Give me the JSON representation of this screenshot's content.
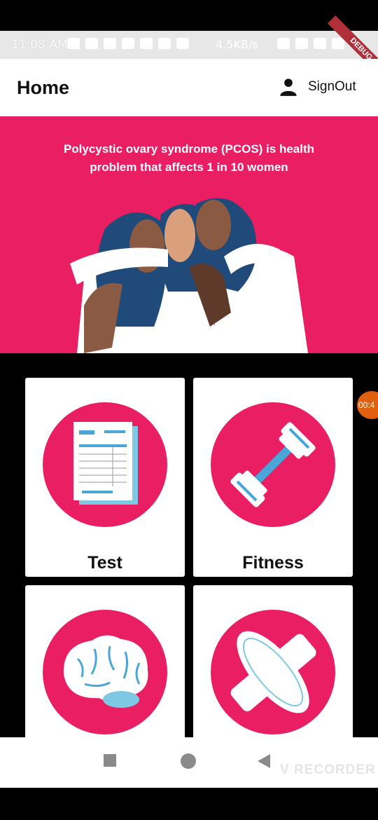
{
  "status": {
    "time": "11:08 AM",
    "speed": "4.5KB/s",
    "debug": "DEBUG",
    "notification_count": "16"
  },
  "appbar": {
    "title": "Home",
    "signout_label": "SignOut"
  },
  "banner": {
    "text": "Polycystic ovary syndrome (PCOS) is health problem that affects 1 in 10 women"
  },
  "cards": [
    {
      "label": "Test",
      "icon": "document-icon"
    },
    {
      "label": "Fitness",
      "icon": "dumbbell-icon"
    },
    {
      "label": "",
      "icon": "brain-icon"
    },
    {
      "label": "",
      "icon": "sanitary-pad-icon"
    }
  ],
  "overlay": {
    "timer": "00:4",
    "recorder": "V RECORDER"
  },
  "colors": {
    "accent": "#e91e63",
    "card": "#ffffff",
    "background": "#000000"
  }
}
